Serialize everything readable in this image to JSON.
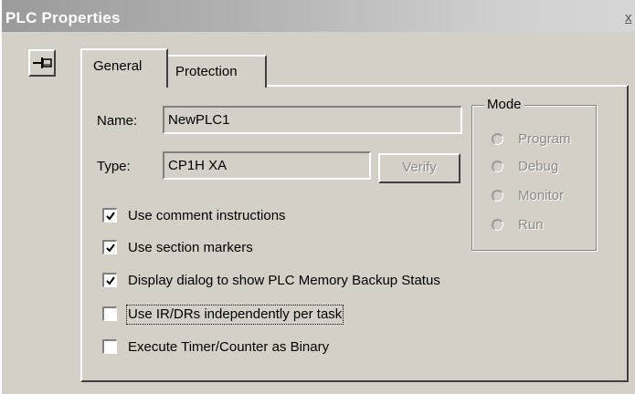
{
  "window": {
    "title": "PLC Properties",
    "close_symbol": "x"
  },
  "pin_button": {
    "icon": "pushpin-icon"
  },
  "tabs": [
    {
      "label": "General",
      "selected": true
    },
    {
      "label": "Protection",
      "selected": false
    }
  ],
  "general": {
    "name_label": "Name:",
    "name_value": "NewPLC1",
    "type_label": "Type:",
    "type_value": "CP1H XA",
    "verify_label": "Verify",
    "mode": {
      "legend": "Mode",
      "options": [
        {
          "label": "Program",
          "selected": false,
          "enabled": false
        },
        {
          "label": "Debug",
          "selected": false,
          "enabled": false
        },
        {
          "label": "Monitor",
          "selected": false,
          "enabled": false
        },
        {
          "label": "Run",
          "selected": false,
          "enabled": false
        }
      ]
    },
    "options": [
      {
        "label": "Use comment instructions",
        "checked": true
      },
      {
        "label": "Use section markers",
        "checked": true
      },
      {
        "label": "Display dialog to show PLC Memory Backup Status",
        "checked": true
      },
      {
        "label": "Use IR/DRs independently per task",
        "checked": false,
        "focused": true
      },
      {
        "label": "Execute Timer/Counter as Binary",
        "checked": false
      }
    ]
  }
}
